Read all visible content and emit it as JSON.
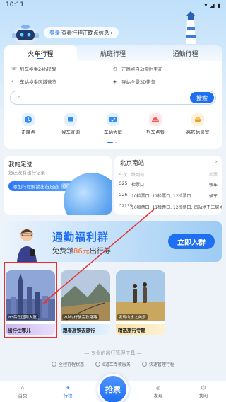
{
  "status_bar": {
    "time": "10:11",
    "icons": [
      "wifi-icon",
      "signal-icon",
      "battery-icon"
    ]
  },
  "banner": {
    "login_link": "登录",
    "text": "查看行程正晚点信息"
  },
  "tabs": [
    {
      "label": "火车行程",
      "active": true
    },
    {
      "label": "航班行程",
      "active": false
    },
    {
      "label": "通勤行程",
      "active": false
    }
  ],
  "features": [
    "列车换乘24h提醒",
    "正晚点自动实时更新",
    "车站换乘区域速览",
    "导站全景3D带领"
  ],
  "search": {
    "button_label": "搜索"
  },
  "quick_actions": [
    {
      "label": "正晚点",
      "icon": "clock-icon",
      "color": "#2f8cf0"
    },
    {
      "label": "候车查询",
      "icon": "seat-icon",
      "color": "#2f8cf0"
    },
    {
      "label": "车站大屏",
      "icon": "screen-icon",
      "color": "#2f8cf0"
    },
    {
      "label": "列车点餐",
      "icon": "meal-icon",
      "color": "#f05a5a"
    },
    {
      "label": "高铁休息室",
      "icon": "lounge-icon",
      "color": "#f0a020"
    }
  ],
  "footprint": {
    "title": "我的足迹",
    "subtitle": "您还没有出行记录",
    "button_label": "添加行程解锁出行足迹",
    "button_go": "GO"
  },
  "station": {
    "title": "北京南站",
    "headers": [
      "车次",
      "终到站",
      "检票"
    ],
    "rows": [
      {
        "train": "G25",
        "status": "检票口",
        "dest": "候车"
      },
      {
        "train": "G26",
        "status": "10检票口, 11检票口, 12检票口",
        "dest": "候车"
      },
      {
        "train": "C2135",
        "status": "10检票口, 11检票口, 12检票口, 南站地下二层",
        "dest": "候车"
      }
    ]
  },
  "promo": {
    "title": "通勤福利群",
    "sub_prefix": "免费领",
    "amount": "86元",
    "sub_suffix": "出行券",
    "button_label": "立即入群"
  },
  "tiles": [
    {
      "caption": "83后任国际大厦",
      "label": "出行住哪儿"
    },
    {
      "caption": "2小时行驶完铁路路",
      "label": "跟着高铁去旅行"
    },
    {
      "caption": "发现山水之美景",
      "label": "精选旅行专题"
    }
  ],
  "slogan": "专业的出行管理工具",
  "services": [
    "全程行程状态",
    "8道车专项服务",
    "快速管理行程"
  ],
  "nav": [
    {
      "label": "首页",
      "icon": "home-icon",
      "active": false
    },
    {
      "label": "行程",
      "icon": "plane-icon",
      "active": true
    },
    {
      "label": "抢票",
      "icon": "ticket-icon",
      "active": false
    },
    {
      "label": "发现",
      "icon": "discover-icon",
      "active": false
    },
    {
      "label": "我的",
      "icon": "profile-icon",
      "active": false
    }
  ]
}
